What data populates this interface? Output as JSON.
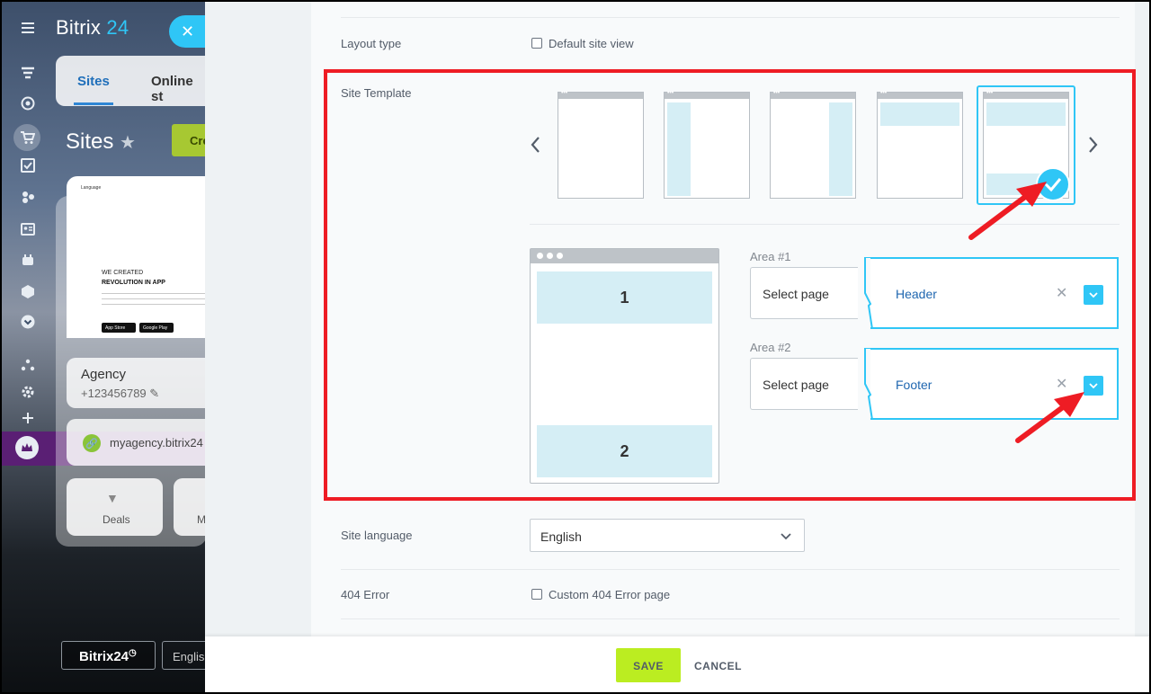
{
  "portal": {
    "brand_name": "Bitrix",
    "brand_suffix": "24",
    "close_icon": "✕",
    "tabs": [
      {
        "label": "Sites"
      },
      {
        "label": "Online st"
      }
    ],
    "sites_title": "Sites",
    "create_label": "Cre",
    "card_preview": {
      "top_link": "Language",
      "line1": "WE CREATED",
      "line2": "REVOLUTION IN APP",
      "store1": "App Store",
      "store2": "Google Play"
    },
    "agency_name": "Agency",
    "agency_phone": "+123456789",
    "site_link": "myagency.bitrix24",
    "deals_label": "Deals",
    "m_label": "M",
    "footer_logo": "Bitrix24",
    "footer_lang": "Englis"
  },
  "form": {
    "layout_type": {
      "label": "Layout type",
      "checkbox_label": "Default site view",
      "checked": false
    },
    "site_template": {
      "label": "Site Template",
      "templates": [
        {
          "name": "empty"
        },
        {
          "name": "left-sidebar"
        },
        {
          "name": "right-sidebar"
        },
        {
          "name": "header"
        },
        {
          "name": "header-footer",
          "selected": true
        }
      ],
      "preview_areas": [
        "1",
        "2"
      ],
      "areas": [
        {
          "label": "Area #1",
          "select_label": "Select page",
          "value": "Header"
        },
        {
          "label": "Area #2",
          "select_label": "Select page",
          "value": "Footer"
        }
      ]
    },
    "site_language": {
      "label": "Site language",
      "value": "English"
    },
    "error_404": {
      "label": "404 Error",
      "checkbox_label": "Custom 404 Error page",
      "checked": false
    }
  },
  "buttons": {
    "save": "SAVE",
    "cancel": "CANCEL"
  },
  "colors": {
    "accent": "#2fc6f6",
    "highlight": "#ee1c24",
    "save": "#bbed21",
    "link": "#2067b0"
  }
}
